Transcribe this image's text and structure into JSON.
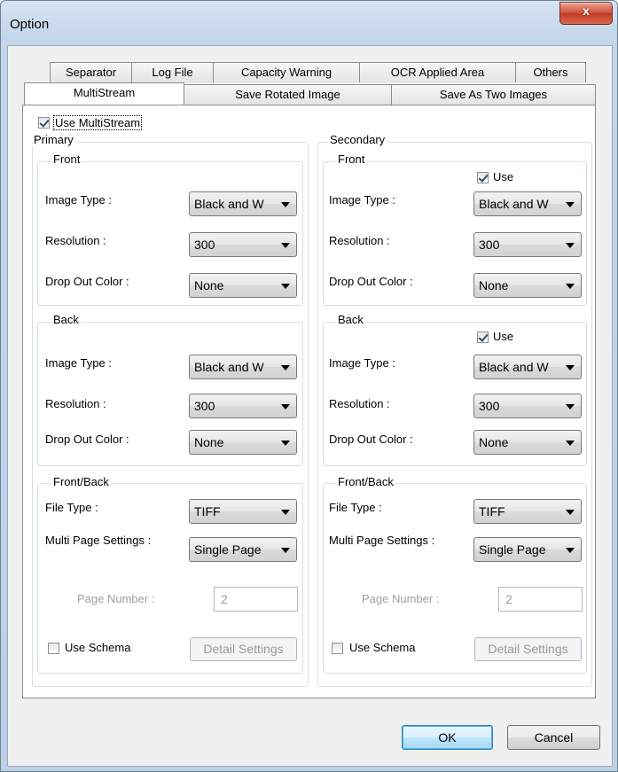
{
  "window": {
    "title": "Option",
    "close_glyph": "x"
  },
  "tabs_row1": [
    {
      "label": "Separator"
    },
    {
      "label": "Log File"
    },
    {
      "label": "Capacity Warning"
    },
    {
      "label": "OCR Applied Area"
    },
    {
      "label": "Others"
    }
  ],
  "tabs_row2": [
    {
      "label": "MultiStream",
      "active": true
    },
    {
      "label": "Save Rotated Image"
    },
    {
      "label": "Save As Two Images"
    }
  ],
  "use_multistream": {
    "label": "Use MultiStream",
    "checked": true
  },
  "primary": {
    "title": "Primary",
    "front": {
      "title": "Front",
      "image_type_label": "Image Type :",
      "image_type": "Black and W",
      "resolution_label": "Resolution :",
      "resolution": "300",
      "dropout_label": "Drop Out Color :",
      "dropout": "None"
    },
    "back": {
      "title": "Back",
      "image_type_label": "Image Type :",
      "image_type": "Black and W",
      "resolution_label": "Resolution :",
      "resolution": "300",
      "dropout_label": "Drop Out Color :",
      "dropout": "None"
    },
    "frontback": {
      "title": "Front/Back",
      "file_type_label": "File Type :",
      "file_type": "TIFF",
      "multipage_label": "Multi Page Settings :",
      "multipage": "Single Page",
      "page_number_label": "Page Number :",
      "page_number": "2",
      "use_schema_label": "Use Schema",
      "use_schema_checked": false,
      "detail_settings_label": "Detail Settings"
    }
  },
  "secondary": {
    "title": "Secondary",
    "front": {
      "title": "Front",
      "use_label": "Use",
      "use_checked": true,
      "image_type_label": "Image Type :",
      "image_type": "Black and W",
      "resolution_label": "Resolution :",
      "resolution": "300",
      "dropout_label": "Drop Out Color :",
      "dropout": "None"
    },
    "back": {
      "title": "Back",
      "use_label": "Use",
      "use_checked": true,
      "image_type_label": "Image Type :",
      "image_type": "Black and W",
      "resolution_label": "Resolution :",
      "resolution": "300",
      "dropout_label": "Drop Out Color :",
      "dropout": "None"
    },
    "frontback": {
      "title": "Front/Back",
      "file_type_label": "File Type :",
      "file_type": "TIFF",
      "multipage_label": "Multi Page Settings :",
      "multipage": "Single Page",
      "page_number_label": "Page Number :",
      "page_number": "2",
      "use_schema_label": "Use Schema",
      "use_schema_checked": false,
      "detail_settings_label": "Detail Settings"
    }
  },
  "buttons": {
    "ok": "OK",
    "cancel": "Cancel"
  }
}
